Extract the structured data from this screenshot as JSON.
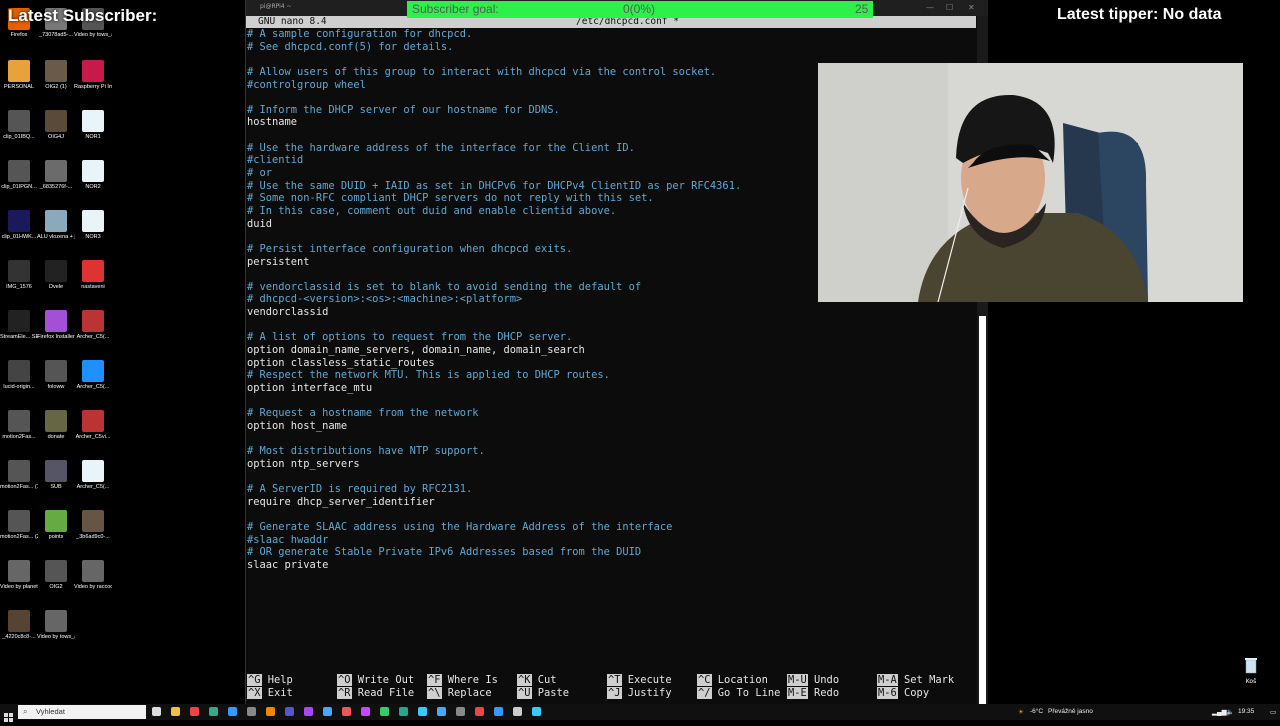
{
  "overlay": {
    "latest_subscriber": "Latest Subscriber:",
    "latest_tipper": "Latest tipper: No data",
    "goal_label": "Subscriber goal:",
    "goal_progress": "0(0%)",
    "goal_target": "25"
  },
  "window": {
    "title": "pi@RPi4 ~",
    "nano_version": "GNU nano 8.4",
    "file_name": "/etc/dhcpcd.conf *"
  },
  "code_lines": [
    {
      "t": "# A sample configuration for dhcpcd.",
      "c": true
    },
    {
      "t": "# See dhcpcd.conf(5) for details.",
      "c": true
    },
    {
      "t": "",
      "c": false
    },
    {
      "t": "# Allow users of this group to interact with dhcpcd via the control socket.",
      "c": true
    },
    {
      "t": "#controlgroup wheel",
      "c": true
    },
    {
      "t": "",
      "c": false
    },
    {
      "t": "# Inform the DHCP server of our hostname for DDNS.",
      "c": true
    },
    {
      "t": "hostname",
      "c": false
    },
    {
      "t": "",
      "c": false
    },
    {
      "t": "# Use the hardware address of the interface for the Client ID.",
      "c": true
    },
    {
      "t": "#clientid",
      "c": true
    },
    {
      "t": "# or",
      "c": true
    },
    {
      "t": "# Use the same DUID + IAID as set in DHCPv6 for DHCPv4 ClientID as per RFC4361.",
      "c": true
    },
    {
      "t": "# Some non-RFC compliant DHCP servers do not reply with this set.",
      "c": true
    },
    {
      "t": "# In this case, comment out duid and enable clientid above.",
      "c": true
    },
    {
      "t": "duid",
      "c": false
    },
    {
      "t": "",
      "c": false
    },
    {
      "t": "# Persist interface configuration when dhcpcd exits.",
      "c": true
    },
    {
      "t": "persistent",
      "c": false
    },
    {
      "t": "",
      "c": false
    },
    {
      "t": "# vendorclassid is set to blank to avoid sending the default of",
      "c": true
    },
    {
      "t": "# dhcpcd-<version>:<os>:<machine>:<platform>",
      "c": true
    },
    {
      "t": "vendorclassid",
      "c": false
    },
    {
      "t": "",
      "c": false
    },
    {
      "t": "# A list of options to request from the DHCP server.",
      "c": true
    },
    {
      "t": "option domain_name_servers, domain_name, domain_search",
      "c": false
    },
    {
      "t": "option classless_static_routes",
      "c": false
    },
    {
      "t": "# Respect the network MTU. This is applied to DHCP routes.",
      "c": true
    },
    {
      "t": "option interface_mtu",
      "c": false
    },
    {
      "t": "",
      "c": false
    },
    {
      "t": "# Request a hostname from the network",
      "c": true
    },
    {
      "t": "option host_name",
      "c": false
    },
    {
      "t": "",
      "c": false
    },
    {
      "t": "# Most distributions have NTP support.",
      "c": true
    },
    {
      "t": "option ntp_servers",
      "c": false
    },
    {
      "t": "",
      "c": false
    },
    {
      "t": "# A ServerID is required by RFC2131.",
      "c": true
    },
    {
      "t": "require dhcp_server_identifier",
      "c": false
    },
    {
      "t": "",
      "c": false
    },
    {
      "t": "# Generate SLAAC address using the Hardware Address of the interface",
      "c": true
    },
    {
      "t": "#slaac hwaddr",
      "c": true
    },
    {
      "t": "# OR generate Stable Private IPv6 Addresses based from the DUID",
      "c": true
    },
    {
      "t": "slaac private",
      "c": false
    }
  ],
  "shortcuts": [
    {
      "k1": "^G",
      "a1": "Help",
      "k2": "^X",
      "a2": "Exit"
    },
    {
      "k1": "^O",
      "a1": "Write Out",
      "k2": "^R",
      "a2": "Read File"
    },
    {
      "k1": "^F",
      "a1": "Where Is",
      "k2": "^\\",
      "a2": "Replace"
    },
    {
      "k1": "^K",
      "a1": "Cut",
      "k2": "^U",
      "a2": "Paste"
    },
    {
      "k1": "^T",
      "a1": "Execute",
      "k2": "^J",
      "a2": "Justify"
    },
    {
      "k1": "^C",
      "a1": "Location",
      "k2": "^/",
      "a2": "Go To Line"
    },
    {
      "k1": "M-U",
      "a1": "Undo",
      "k2": "M-E",
      "a2": "Redo"
    },
    {
      "k1": "M-A",
      "a1": "Set Mark",
      "k2": "M-6",
      "a2": "Copy"
    }
  ],
  "desktop_icons": [
    {
      "label": "Firefox",
      "color": "#e66000"
    },
    {
      "label": "_73078ad5-...",
      "color": "#777"
    },
    {
      "label": "Video by tows_and_t...",
      "color": "#555"
    },
    {
      "label": "PERSONAL",
      "color": "#e8a23a"
    },
    {
      "label": "OIG2 (1)",
      "color": "#6a5a4a"
    },
    {
      "label": "Raspberry Pi Imager",
      "color": "#c51a4a"
    },
    {
      "label": "clip_01IBQ...",
      "color": "#555"
    },
    {
      "label": "OIG4J",
      "color": "#5a4a3a"
    },
    {
      "label": "NOR1",
      "color": "#e8f4f8"
    },
    {
      "label": "clip_01IPGN...",
      "color": "#555"
    },
    {
      "label": "_6835276f-...",
      "color": "#6b6b6b"
    },
    {
      "label": "NOR2",
      "color": "#e8f4f8"
    },
    {
      "label": "clip_01HWK...",
      "color": "#1a1a5a"
    },
    {
      "label": "ALU vlozena + jednostr...",
      "color": "#88aabb"
    },
    {
      "label": "NOR3",
      "color": "#e8f4f8"
    },
    {
      "label": "IMG_1576",
      "color": "#333"
    },
    {
      "label": "Dvele",
      "color": "#222"
    },
    {
      "label": "nastaveni",
      "color": "#d33"
    },
    {
      "label": "StreamEle... SE.Live",
      "color": "#222"
    },
    {
      "label": "Firefox Installer",
      "color": "#a44fd8"
    },
    {
      "label": "Archer_C5(...",
      "color": "#b33"
    },
    {
      "label": "lucid-origin...",
      "color": "#444"
    },
    {
      "label": "foloww",
      "color": "#555"
    },
    {
      "label": "Archer_C5(...",
      "color": "#1e90ff"
    },
    {
      "label": "motion2Fas...",
      "color": "#555"
    },
    {
      "label": "donate",
      "color": "#664"
    },
    {
      "label": "Archer_C5vi...",
      "color": "#b33"
    },
    {
      "label": "motion2Fas... (1)",
      "color": "#555"
    },
    {
      "label": "SUB",
      "color": "#556"
    },
    {
      "label": "Archer_C5(...",
      "color": "#e8f4f8"
    },
    {
      "label": "motion2Fas... (2)",
      "color": "#555"
    },
    {
      "label": "points",
      "color": "#6a4"
    },
    {
      "label": "_3b6ad9c0-...",
      "color": "#654"
    },
    {
      "label": "Video by planeta_en...",
      "color": "#666"
    },
    {
      "label": "OIG2",
      "color": "#555"
    },
    {
      "label": "Video by raccoon_sc...",
      "color": "#666"
    },
    {
      "label": "_4220c8c8-...",
      "color": "#543"
    },
    {
      "label": "Video by tows_and_t...",
      "color": "#666"
    }
  ],
  "recycle_bin_label": "Koš",
  "taskbar": {
    "search_placeholder": "Vyhledat",
    "temperature": "-6°C",
    "weather": "Převážně jasno",
    "time": "19:35"
  }
}
